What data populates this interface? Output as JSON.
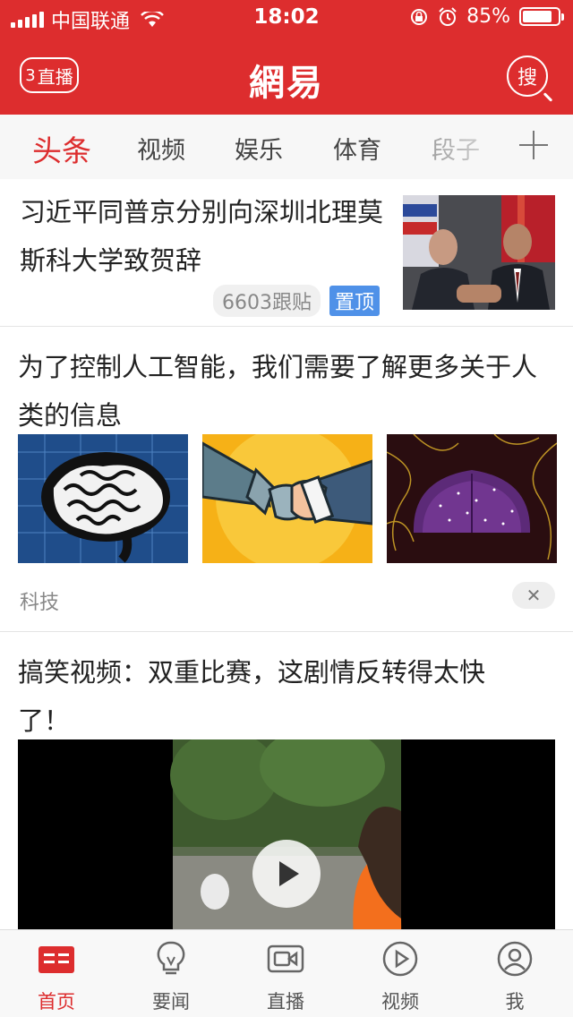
{
  "status_bar": {
    "carrier": "中国联通",
    "time": "18:02",
    "battery": "85%",
    "battery_level": 0.85
  },
  "header": {
    "live_label": "直播",
    "live_count": "3",
    "logo_text": "網易",
    "search_label": "搜"
  },
  "tabs": [
    {
      "label": "头条",
      "active": true
    },
    {
      "label": "视频",
      "active": false
    },
    {
      "label": "娱乐",
      "active": false
    },
    {
      "label": "体育",
      "active": false
    },
    {
      "label": "段子",
      "active": false
    }
  ],
  "feed": [
    {
      "title": "习近平同普京分别向深圳北理莫斯科大学致贺辞",
      "comments": "6603跟贴",
      "badge": "置顶"
    },
    {
      "title": "为了控制人工智能，我们需要了解更多关于人类的信息",
      "category": "科技",
      "close_icon": "close-icon"
    },
    {
      "title": "搞笑视频：双重比赛，这剧情反转得太快了！",
      "play_icon": "play-icon"
    }
  ],
  "tabbar": [
    {
      "label": "首页",
      "icon": "news-icon",
      "active": true
    },
    {
      "label": "要闻",
      "icon": "bulb-icon",
      "active": false
    },
    {
      "label": "直播",
      "icon": "camera-icon",
      "active": false
    },
    {
      "label": "视频",
      "icon": "play-circle-icon",
      "active": false
    },
    {
      "label": "我",
      "icon": "user-icon",
      "active": false
    }
  ],
  "colors": {
    "brand": "#dd2d2e",
    "badge": "#4f91e8"
  }
}
